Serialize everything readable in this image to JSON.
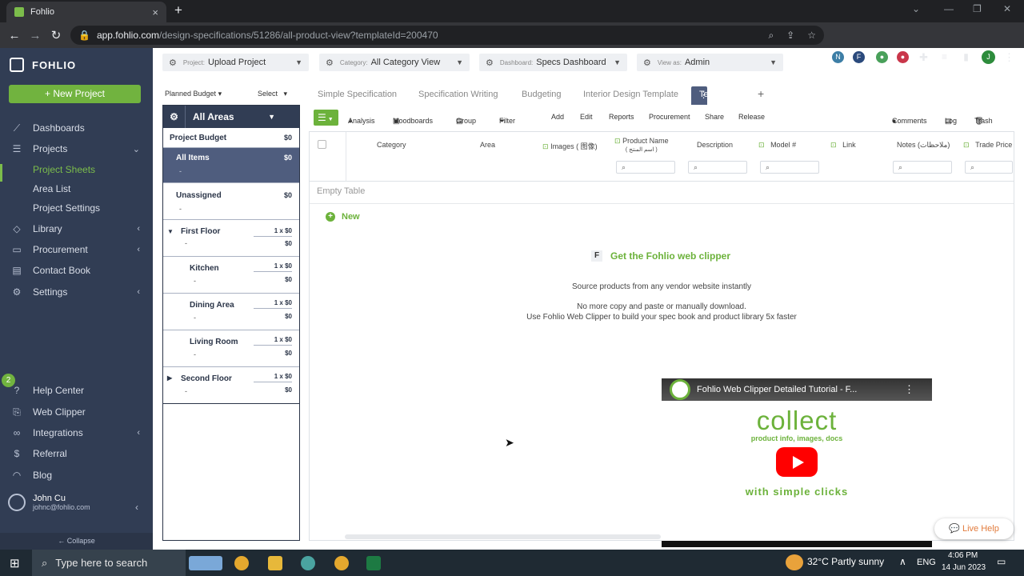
{
  "browser": {
    "tab_title": "Fohlio",
    "url_host": "app.fohlio.com",
    "url_path": "/design-specifications/51286/all-product-view?templateId=200470"
  },
  "sidebar": {
    "brand": "FOHLIO",
    "new_project": "New Project",
    "items": [
      {
        "label": "Dashboards"
      },
      {
        "label": "Projects"
      },
      {
        "label": "Project Sheets"
      },
      {
        "label": "Area List"
      },
      {
        "label": "Project Settings"
      },
      {
        "label": "Library"
      },
      {
        "label": "Procurement"
      },
      {
        "label": "Contact Book"
      },
      {
        "label": "Settings"
      },
      {
        "label": "Help Center"
      },
      {
        "label": "Web Clipper"
      },
      {
        "label": "Integrations"
      },
      {
        "label": "Referral"
      },
      {
        "label": "Blog"
      }
    ],
    "help_badge": "2",
    "user_name": "John Cu",
    "user_email": "johnc@fohlio.com",
    "collapse": "Collapse"
  },
  "filters": {
    "project_label": "Project:",
    "project_value": "Upload Project",
    "category_label": "Category:",
    "category_value": "All Category View",
    "dashboard_label": "Dashboard:",
    "dashboard_value": "Specs Dashboard",
    "viewas_label": "View as:",
    "viewas_value": "Admin"
  },
  "budget_bar": {
    "planned": "Planned Budget",
    "select": "Select"
  },
  "areas": {
    "title": "All Areas",
    "project_budget": "Project Budget",
    "project_budget_amt": "$0",
    "rows": [
      {
        "name": "All Items",
        "amt": "$0",
        "dash": "-"
      },
      {
        "name": "Unassigned",
        "amt": "$0",
        "dash": "-"
      },
      {
        "name": "First Floor",
        "qty": "1 x $0",
        "dash": "-",
        "amt": "$0"
      },
      {
        "name": "Kitchen",
        "qty": "1 x $0",
        "dash": "-",
        "amt": "$0"
      },
      {
        "name": "Dining Area",
        "qty": "1 x $0",
        "dash": "-",
        "amt": "$0"
      },
      {
        "name": "Living Room",
        "qty": "1 x $0",
        "dash": "-",
        "amt": "$0"
      },
      {
        "name": "Second Floor",
        "qty": "1 x $0",
        "dash": "-",
        "amt": "$0"
      }
    ]
  },
  "tabs": [
    "Simple Specification",
    "Specification Writing",
    "Budgeting",
    "Interior Design Template",
    "Test Phase"
  ],
  "toolbar": {
    "analysis": "Analysis",
    "moodboards": "Moodboards",
    "group": "Group",
    "filter": "Filter",
    "add": "Add",
    "edit": "Edit",
    "reports": "Reports",
    "procurement": "Procurement",
    "share": "Share",
    "release": "Release",
    "comments": "Comments",
    "log": "Log",
    "trash": "Trash"
  },
  "table": {
    "columns": [
      "Category",
      "Area",
      "Images ( 图像)",
      "Product Name",
      "( اسم المنتج )",
      "Description",
      "Model #",
      "Link",
      "Notes (ملاحظات)",
      "Trade Price"
    ],
    "empty": "Empty Table",
    "new": "New"
  },
  "clipper": {
    "title": "Get the Fohlio web clipper",
    "line1": "Source products from any vendor website instantly",
    "line2": "No more copy and paste or manually download.",
    "line3": "Use Fohlio Web Clipper to build your spec book and product library 5x faster"
  },
  "video": {
    "title": "Fohlio Web Clipper Detailed Tutorial - F...",
    "collect": "collect",
    "sub": "product info, images, docs",
    "simple": "with simple clicks"
  },
  "live_help": "Live Help",
  "taskbar": {
    "search": "Type here to search",
    "weather": "32°C  Partly sunny",
    "lang": "ENG",
    "time": "4:06 PM",
    "date": "14 Jun 2023"
  }
}
